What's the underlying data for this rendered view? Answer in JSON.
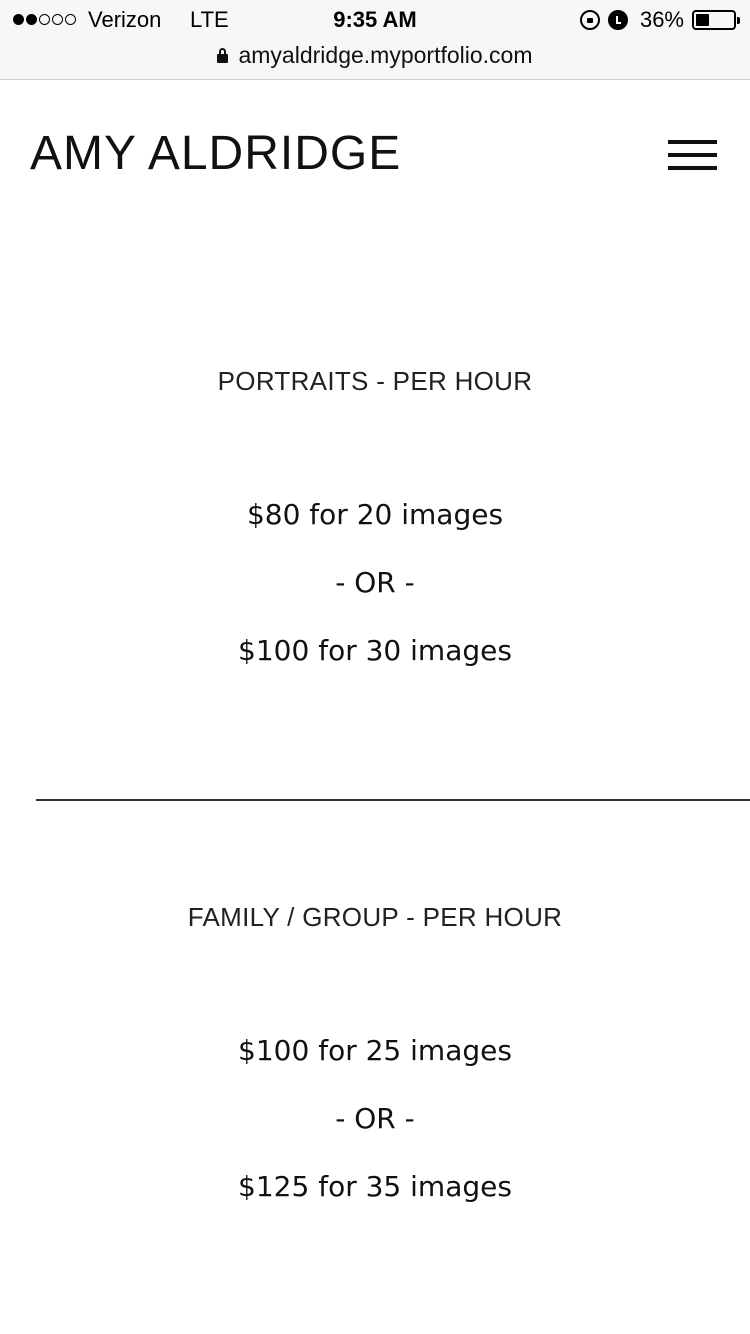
{
  "status_bar": {
    "carrier": "Verizon",
    "network": "LTE",
    "time": "9:35 AM",
    "battery_percent": "36%",
    "battery_level": 0.36,
    "signal_bars_filled": 2,
    "signal_bars_total": 5
  },
  "browser": {
    "url": "amyaldridge.myportfolio.com"
  },
  "header": {
    "site_title": "AMY ALDRIDGE",
    "menu_icon": "hamburger-menu-icon"
  },
  "pricing": {
    "portraits": {
      "heading": "PORTRAITS - PER HOUR",
      "option_1": "$80 for 20 images",
      "separator": "- OR -",
      "option_2": "$100 for 30 images"
    },
    "family_group": {
      "heading": "FAMILY / GROUP - PER HOUR",
      "option_1": "$100 for 25 images",
      "separator": "- OR -",
      "option_2": "$125 for 35 images"
    }
  }
}
